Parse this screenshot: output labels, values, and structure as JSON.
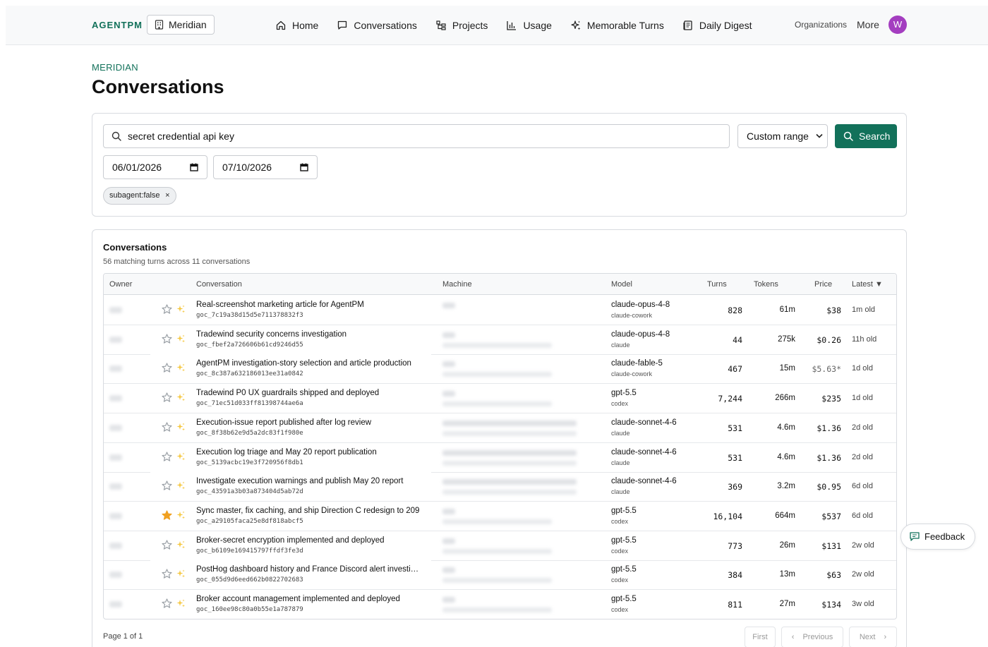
{
  "brand": "AGENTPM",
  "org_chip": "Meridian",
  "nav": [
    {
      "label": "Home",
      "icon": "home-icon"
    },
    {
      "label": "Conversations",
      "icon": "chat-icon"
    },
    {
      "label": "Projects",
      "icon": "projects-icon"
    },
    {
      "label": "Usage",
      "icon": "bar-chart-icon"
    },
    {
      "label": "Memorable Turns",
      "icon": "sparkle-icon"
    },
    {
      "label": "Daily Digest",
      "icon": "newspaper-icon"
    }
  ],
  "organizations_link": "Organizations",
  "more_link": "More",
  "avatar_initial": "W",
  "breadcrumb": "MERIDIAN",
  "page_title": "Conversations",
  "filters": {
    "search_value": "secret credential api key",
    "range_select": "Custom range",
    "search_button": "Search",
    "date_from": "06/01/2026",
    "date_to": "07/10/2026",
    "chip": "subagent:false",
    "chip_remove": "×"
  },
  "results": {
    "title": "Conversations",
    "summary": "56 matching turns across 11 conversations",
    "columns": {
      "owner": "Owner",
      "conversation": "Conversation",
      "machine": "Machine",
      "model": "Model",
      "turns": "Turns",
      "tokens": "Tokens",
      "price": "Price",
      "latest": "Latest ▼"
    },
    "rows": [
      {
        "title": "Real-screenshot marketing article for AgentPM",
        "id": "goc_7c19a38d15d5e711378832f3",
        "starred": false,
        "model": "claude-opus-4-8",
        "model_sub": "claude-cowork",
        "turns": "828",
        "tokens": "61m",
        "price": "$38",
        "latest": "1m old",
        "machine_w": [
          18,
          0
        ]
      },
      {
        "title": "Tradewind security concerns investigation",
        "id": "goc_fbef2a726606b61cd9246d55",
        "starred": false,
        "model": "claude-opus-4-8",
        "model_sub": "claude",
        "turns": "44",
        "tokens": "275k",
        "price": "$0.26",
        "latest": "11h old",
        "machine_w": [
          18,
          155
        ]
      },
      {
        "title": "AgentPM investigation-story selection and article production",
        "id": "goc_8c387a632186013ee31a0842",
        "starred": false,
        "model": "claude-fable-5",
        "model_sub": "claude-cowork",
        "turns": "467",
        "tokens": "15m",
        "price": "$5.63*",
        "latest": "1d old",
        "machine_w": [
          18,
          155
        ]
      },
      {
        "title": "Tradewind P0 UX guardrails shipped and deployed",
        "id": "goc_71ec51d033ff81398744ae6a",
        "starred": false,
        "model": "gpt-5.5",
        "model_sub": "codex",
        "turns": "7,244",
        "tokens": "266m",
        "price": "$235",
        "latest": "1d old",
        "machine_w": [
          18,
          155
        ]
      },
      {
        "title": "Execution-issue report published after log review",
        "id": "goc_8f38b62e9d5a2dc83f1f980e",
        "starred": false,
        "model": "claude-sonnet-4-6",
        "model_sub": "claude",
        "turns": "531",
        "tokens": "4.6m",
        "price": "$1.36",
        "latest": "2d old",
        "machine_w": [
          190,
          190
        ]
      },
      {
        "title": "Execution log triage and May 20 report publication",
        "id": "goc_5139acbc19e3f720956f8db1",
        "starred": false,
        "model": "claude-sonnet-4-6",
        "model_sub": "claude",
        "turns": "531",
        "tokens": "4.6m",
        "price": "$1.36",
        "latest": "2d old",
        "machine_w": [
          190,
          190
        ]
      },
      {
        "title": "Investigate execution warnings and publish May 20 report",
        "id": "goc_43591a3b03a873404d5ab72d",
        "starred": false,
        "model": "claude-sonnet-4-6",
        "model_sub": "claude",
        "turns": "369",
        "tokens": "3.2m",
        "price": "$0.95",
        "latest": "6d old",
        "machine_w": [
          190,
          190
        ]
      },
      {
        "title": "Sync master, fix caching, and ship Direction C redesign to 209",
        "id": "goc_a29105faca25e8df818abcf5",
        "starred": true,
        "model": "gpt-5.5",
        "model_sub": "codex",
        "turns": "16,104",
        "tokens": "664m",
        "price": "$537",
        "latest": "6d old",
        "machine_w": [
          18,
          155
        ]
      },
      {
        "title": "Broker-secret encryption implemented and deployed",
        "id": "goc_b6109e169415797ffdf3fe3d",
        "starred": false,
        "model": "gpt-5.5",
        "model_sub": "codex",
        "turns": "773",
        "tokens": "26m",
        "price": "$131",
        "latest": "2w old",
        "machine_w": [
          18,
          155
        ]
      },
      {
        "title": "PostHog dashboard history and France Discord alert investi…",
        "id": "goc_055d9d6eed662b0822702683",
        "starred": false,
        "model": "gpt-5.5",
        "model_sub": "codex",
        "turns": "384",
        "tokens": "13m",
        "price": "$63",
        "latest": "2w old",
        "machine_w": [
          18,
          155
        ]
      },
      {
        "title": "Broker account management implemented and deployed",
        "id": "goc_160ee98c80a0b55e1a787879",
        "starred": false,
        "model": "gpt-5.5",
        "model_sub": "codex",
        "turns": "811",
        "tokens": "27m",
        "price": "$134",
        "latest": "3w old",
        "machine_w": [
          18,
          155
        ]
      }
    ]
  },
  "pager": {
    "text": "Page 1 of 1",
    "first": "First",
    "previous": "Previous",
    "next": "Next"
  },
  "feedback_button": "Feedback",
  "colors": {
    "accent": "#12715a",
    "avatar": "#a43ec0",
    "star_active": "#f0a020",
    "star_inactive": "#9aa0a6",
    "sparkle": "#f5c842"
  }
}
